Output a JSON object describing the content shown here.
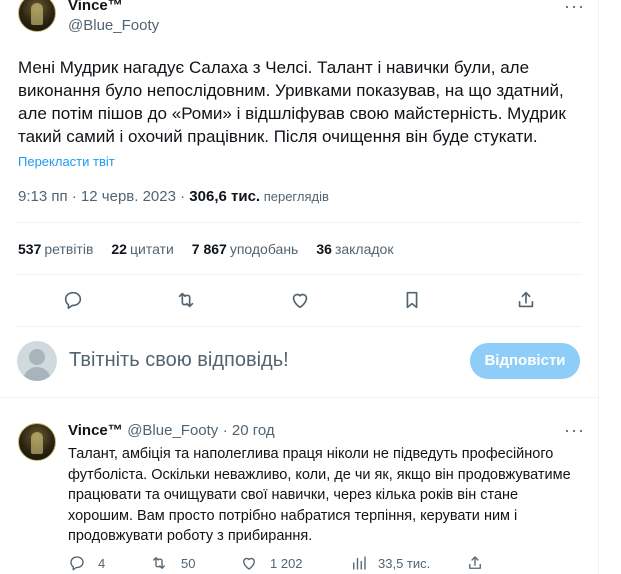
{
  "tweet": {
    "author_name": "Vince™",
    "author_handle": "@Blue_Footy",
    "more": "···",
    "text": "Мені Мудрик нагадує Салаха з Челсі. Талант і навички були, але виконання було непослідовним. Уривками показував, на що здатний, але потім пішов до «Роми» і відшліфував свою майстерність. Мудрик такий самий і охочий працівник. Після очищення він буде стукати.",
    "translate_label": "Перекласти твіт",
    "time": "9:13 пп · 12 черв. 2023 · ",
    "views_value": "306,6 тис.",
    "views_label": " переглядів"
  },
  "stats": [
    {
      "value": "537",
      "label": "ретвітів"
    },
    {
      "value": "22",
      "label": "цитати"
    },
    {
      "value": "7 867",
      "label": "уподобань"
    },
    {
      "value": "36",
      "label": "закладок"
    }
  ],
  "actions": {
    "icons": [
      "reply-icon",
      "retweet-icon",
      "like-icon",
      "bookmark-icon",
      "share-icon"
    ]
  },
  "composer": {
    "placeholder": "Твітніть свою відповідь!",
    "button_label": "Відповісти"
  },
  "reply": {
    "author_name": "Vince™",
    "author_handle": "@Blue_Footy",
    "age": "· 20 год",
    "more": "···",
    "text": "Талант, амбіція та наполеглива праця ніколи не підведуть професійного футболіста. Оскільки неважливо, коли, де чи як, якщо він продовжуватиме працювати та очищувати свої навички, через кілька років він стане хорошим. Вам просто потрібно набратися терпіння, керувати ним і продовжувати роботу з прибирання.",
    "reply_count": "4",
    "retweet_count": "50",
    "like_count": "1 202",
    "views_count": "33,5 тис."
  },
  "colors": {
    "accent": "#1d9bf0",
    "button_disabled": "#8ecdf8",
    "secondary_text": "#536471",
    "divider": "#eff3f4"
  }
}
